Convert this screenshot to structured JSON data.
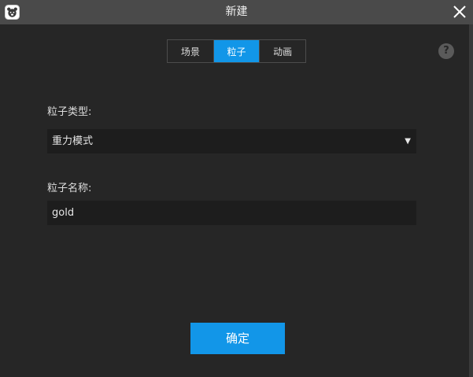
{
  "window": {
    "title": "新建",
    "app_icon": "bear-logo-icon",
    "close_icon": "close-icon"
  },
  "tabs": [
    {
      "label": "场景",
      "active": false
    },
    {
      "label": "粒子",
      "active": true
    },
    {
      "label": "动画",
      "active": false
    }
  ],
  "help": {
    "glyph": "?"
  },
  "form": {
    "type_label": "粒子类型:",
    "type_value": "重力模式",
    "name_label": "粒子名称:",
    "name_value": "gold"
  },
  "actions": {
    "confirm_label": "确定"
  },
  "colors": {
    "accent": "#1296e8",
    "titlebar": "#4a4a4a",
    "background": "#262626",
    "field": "#1d1d1d"
  }
}
